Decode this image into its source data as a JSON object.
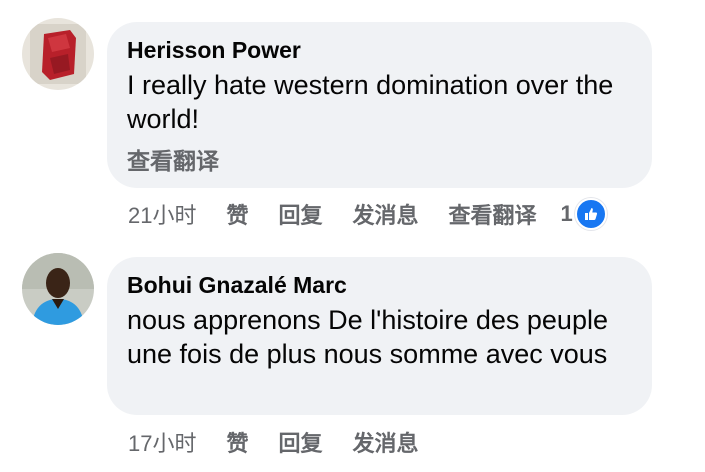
{
  "comments": [
    {
      "author": "Herisson Power",
      "text": "I really hate western domination over the world!",
      "translate_link": "查看翻译",
      "time": "21小时",
      "like": "赞",
      "reply": "回复",
      "message": "发消息",
      "translate": "查看翻译",
      "reaction_count": "1"
    },
    {
      "author": "Bohui Gnazalé Marc",
      "text": "nous apprenons De l'histoire des peuple une fois de plus nous somme avec vous",
      "time": "17小时",
      "like": "赞",
      "reply": "回复",
      "message": "发消息"
    }
  ],
  "colors": {
    "bubble": "#f0f2f5",
    "secondary_text": "#65676b",
    "like_blue": "#1877f2"
  }
}
